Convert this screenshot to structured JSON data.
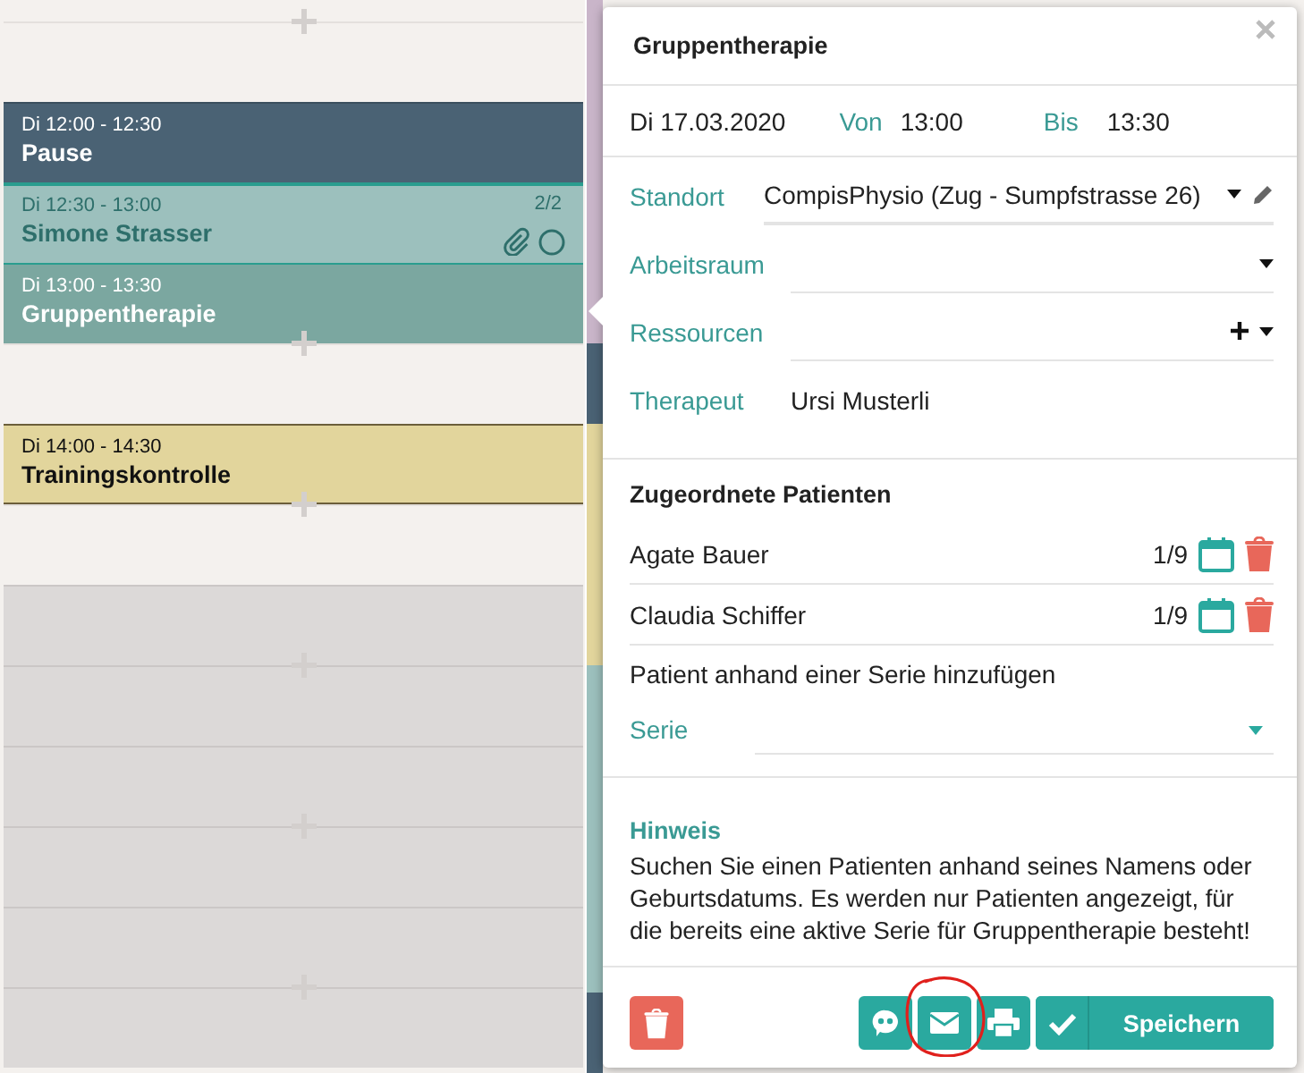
{
  "calendar": {
    "slots": [
      {
        "disabled": false
      },
      {
        "event": {
          "kind": "pause",
          "time": "Di 12:00 - 12:30",
          "title": "Pause"
        }
      },
      {
        "event": {
          "kind": "patient",
          "time": "Di 12:30 - 13:00",
          "title": "Simone Strasser",
          "count": "2/2"
        }
      },
      {
        "event": {
          "kind": "group",
          "time": "Di 13:00 - 13:30",
          "title": "Gruppentherapie"
        }
      },
      {
        "disabled": false
      },
      {
        "event": {
          "kind": "training",
          "time": "Di 14:00 - 14:30",
          "title": "Trainingskontrolle"
        }
      },
      {
        "disabled": false
      },
      {
        "disabled": true
      },
      {
        "disabled": true
      },
      {
        "disabled": true
      },
      {
        "disabled": true
      },
      {
        "disabled": true
      },
      {
        "disabled": true
      }
    ]
  },
  "popup": {
    "title": "Gruppentherapie",
    "date": "Di 17.03.2020",
    "from_label": "Von",
    "from": "13:00",
    "to_label": "Bis",
    "to": "13:30",
    "fields": [
      {
        "kind": "select-edit",
        "label": "Standort",
        "value": "CompisPhysio (Zug - Sumpfstrasse 26)"
      },
      {
        "kind": "select",
        "label": "Arbeitsraum"
      },
      {
        "kind": "select-add",
        "label": "Ressourcen"
      },
      {
        "kind": "text",
        "label": "Therapeut",
        "value": "Ursi Musterli"
      }
    ],
    "patients_title": "Zugeordnete Patienten",
    "patients": [
      {
        "name": "Agate Bauer",
        "count": "1/9"
      },
      {
        "name": "Claudia Schiffer",
        "count": "1/9"
      }
    ],
    "add_title": "Patient anhand einer Serie hinzufügen",
    "series_label": "Serie",
    "hint_title": "Hinweis",
    "hint_text": "Suchen Sie einen Patienten anhand seines Namens oder Geburtsdatums. Es werden nur Patienten angezeigt, für die bereits eine aktive Serie für Gruppentherapie besteht!",
    "save_label": "Speichern"
  }
}
